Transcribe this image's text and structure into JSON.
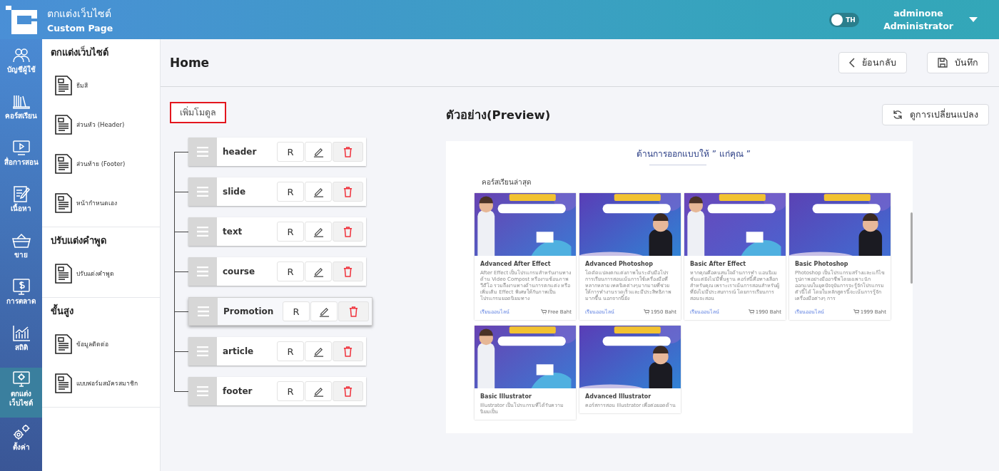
{
  "app": {
    "title": "ตกแต่งเว็บไซต์",
    "subtitle": "Custom Page"
  },
  "language_toggle": {
    "label": "TH",
    "on": false
  },
  "user": {
    "name": "adminone",
    "role": "Administrator"
  },
  "nav": [
    {
      "label": "บัญชีผู้ใช้",
      "selected": false
    },
    {
      "label": "คอร์สเรียน",
      "selected": false
    },
    {
      "label": "สื่อการสอน",
      "selected": false
    },
    {
      "label": "เนื้อหา",
      "selected": false
    },
    {
      "label": "ขาย",
      "selected": false
    },
    {
      "label": "การตลาด",
      "selected": false
    },
    {
      "label": "สถิติ",
      "selected": false
    },
    {
      "label": "ตกแต่งเว็บไซต์",
      "selected": true
    },
    {
      "label": "ตั้งค่า",
      "selected": false
    }
  ],
  "submenu": [
    {
      "heading": "ตกแต่งเว็บไซต์",
      "items": [
        "ธีมสี",
        "ส่วนหัว (Header)",
        "ส่วนท้าย (Footer)",
        "หน้ากำหนดเอง"
      ]
    },
    {
      "heading": "ปรับแต่งคำพูด",
      "items": [
        "ปรับแต่งคำพูด"
      ]
    },
    {
      "heading": "ขั้นสูง",
      "items": [
        "ข้อมูลติดต่อ",
        "แบบฟอร์มสมัครสมาชิก"
      ]
    }
  ],
  "page": {
    "title": "Home",
    "back_button": "ย้อนกลับ",
    "save_button": "บันทึก"
  },
  "add_module_button": "เพิ่มโมดูล",
  "modules": [
    {
      "name": "header",
      "r_button": "R",
      "highlighted": false
    },
    {
      "name": "slide",
      "r_button": "R",
      "highlighted": false
    },
    {
      "name": "text",
      "r_button": "R",
      "highlighted": false
    },
    {
      "name": "course",
      "r_button": "R",
      "highlighted": false
    },
    {
      "name": "Promotion",
      "r_button": "R",
      "highlighted": true
    },
    {
      "name": "article",
      "r_button": "R",
      "highlighted": false
    },
    {
      "name": "footer",
      "r_button": "R",
      "highlighted": false
    }
  ],
  "preview": {
    "title": "ตัวอย่าง(Preview)",
    "refresh_button": "ดูการเปลี่ยนแปลง",
    "tagline": "ด้านการออกแบบให้  ” แก่คุณ ”",
    "section_title": "คอร์สเรียนล่าสุด",
    "courses": [
      {
        "title": "Advanced After Effect",
        "description": "After Effect เป็นโปรแกรมสำหรับงานทางด้าน Video Compost หรืองานซ้อนภาพวีดีโอ รวมถึงงานทางด้านการตกแต่ง หรือเพิ่มเติม Effect พิเศษให้กับภาพเป็นโปรแกรมยอดนิยมทาง",
        "link": "เรียนออนไลน์",
        "price": "Free Baht"
      },
      {
        "title": "Advanced Photoshop",
        "description": "โดดัดแปลงตกแต่งภาพในระดับมือโปร การเรียนการสอนเน้นการใช้เครื่องมือที่หลากหลาย เทคนิคต่างๆมากมายที่ช่วยให้การทำงานรวดเร็วและมีประสิทธิภาพมากขึ้น นอกจากนี้ยัง",
        "link": "เรียนออนไลน์",
        "price": "1950 Baht"
      },
      {
        "title": "Basic After Effect",
        "description": "หากคุณคือคนสนใจด้านการทำ แอนนิเมชั่นแต่ยังไม่มีพื้นฐาน คอร์สนี้คือทางเลือกสำหรับคุณ เพราะเราเน้นการสอนสำหรับผู้ที่ยังไม่มีประสบการณ์ โดยการเรียนการสอนจะสอน",
        "link": "เรียนออนไลน์",
        "price": "1990 Baht"
      },
      {
        "title": "Basic Photoshop",
        "description": "Photoshop เป็นโปรแกรมสร้างและแก้ไขรูปภาพอย่างมืออาชีพโดยเฉพาะนักออกแบบในยุคปัจจุบันการจะรู้จักโปรแกรมตัวนี้ได้ โดยในหลักสูตรนี้จะเน้นการรู้จักเครื่องมือต่างๆ การ",
        "link": "เรียนออนไลน์",
        "price": "1999 Baht"
      },
      {
        "title": "Basic Illustrator",
        "description": "Illustrator เป็นโปรแกรมที่ได้รับความนิยมเป็น"
      },
      {
        "title": "Advanced Illustrator",
        "description": "คอร์สการสอน Illustrator เพื่อต่อยอดด้าน"
      }
    ]
  }
}
